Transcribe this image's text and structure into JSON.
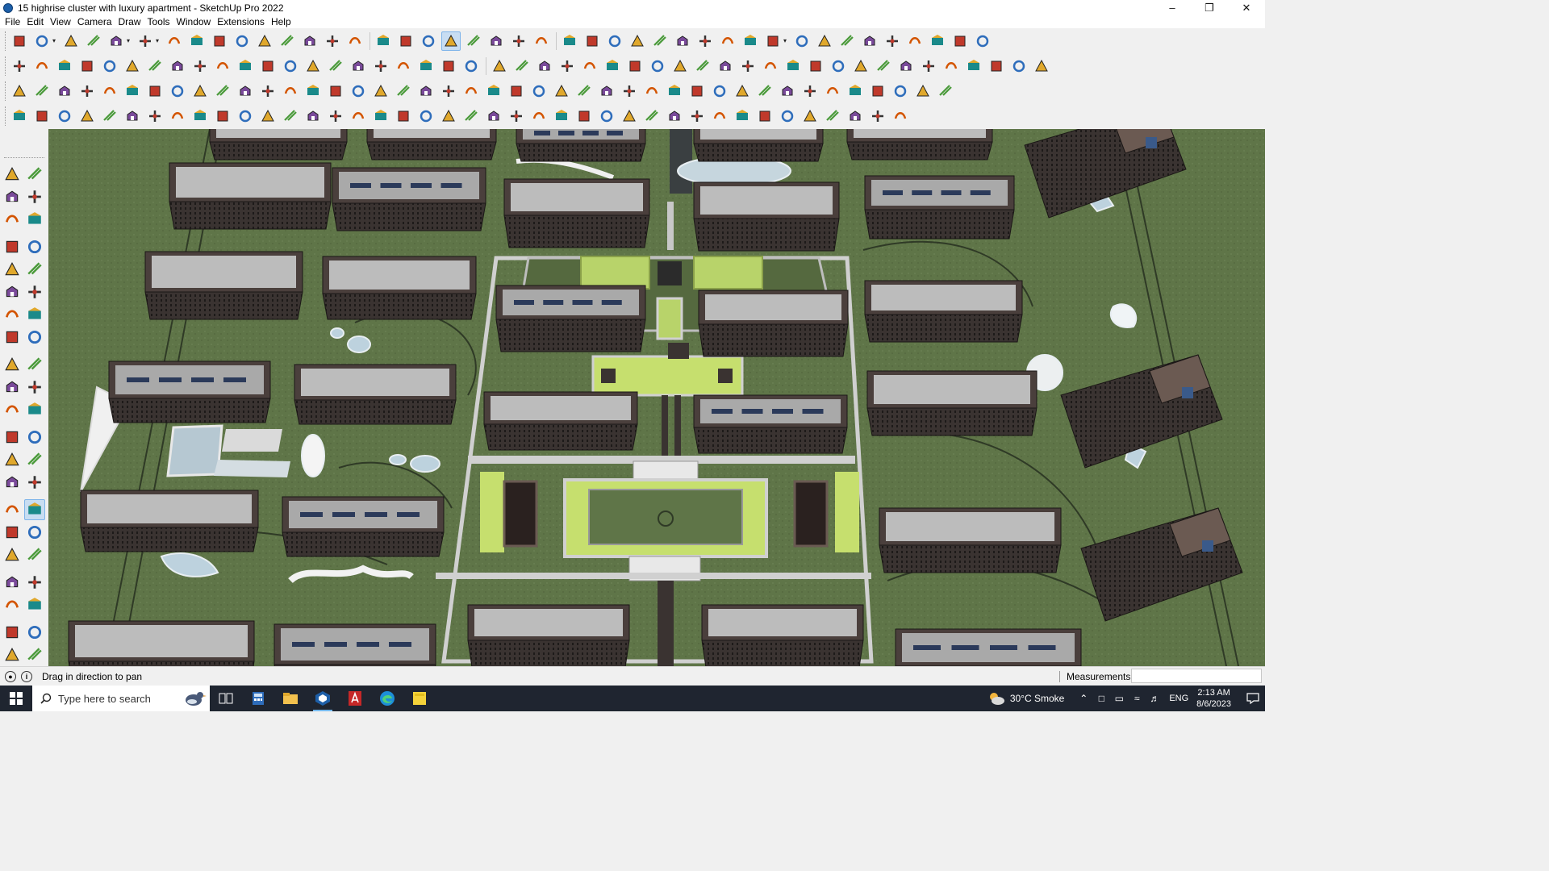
{
  "window": {
    "title": "15 highrise cluster with luxury apartment - SketchUp Pro 2022",
    "icons": [
      "sketchup-icon",
      "minimize-icon",
      "maximize-icon",
      "close-icon"
    ]
  },
  "menubar": [
    "File",
    "Edit",
    "View",
    "Camera",
    "Draw",
    "Tools",
    "Window",
    "Extensions",
    "Help"
  ],
  "toolbars": {
    "row1": [
      "zoom-extents",
      "select",
      "eraser",
      "line",
      "arc",
      "rectangle",
      "push-pull",
      "follow-me",
      "move",
      "rotate",
      "scale",
      "tape-measure",
      "text",
      "paint-bucket",
      "orbit",
      "pan",
      "zoom",
      "zoom-window",
      "styles",
      "section-plane",
      "layers",
      "components",
      "geolocation",
      "model-info",
      "shadow",
      "fog",
      "axis",
      "camera",
      "undo",
      "redo",
      "warehouse"
    ],
    "row2": [
      "components",
      "materials",
      "styles",
      "push-pull-extended",
      "move-x",
      "move-y",
      "move-z",
      "curve",
      "sandbox",
      "roof",
      "house",
      "walls",
      "terrain",
      "text-3d",
      "tape",
      "circles",
      "polygons",
      "arcs",
      "paint",
      "extrude",
      "solid"
    ],
    "row3": [
      "plane-blue",
      "plane-yellow",
      "plane-green",
      "plane-red",
      "offset",
      "polyline",
      "array",
      "section",
      "rotate-copy",
      "joint",
      "weld",
      "spline",
      "ortho",
      "scale-tool",
      "vertex",
      "grid",
      "hatch",
      "explode",
      "cluster"
    ],
    "row4": [
      "draw-edge",
      "bezier",
      "fillet",
      "chamfer",
      "lattice",
      "unfold",
      "bend",
      "loft",
      "sphere",
      "shell",
      "corner",
      "stair",
      "railing",
      "window-frame",
      "roof-truss",
      "beam",
      "grid-lines",
      "panel"
    ]
  },
  "left_toolbar": {
    "tools": [
      "select-icon",
      "orbit-icon",
      "paint-bucket-icon",
      "eraser-icon",
      "component-icon",
      "tape-icon",
      "pencil-icon",
      "freehand-icon",
      "rectangle-icon",
      "rotated-rect-icon",
      "circle-icon",
      "polygon-icon",
      "arc-icon",
      "arc-2point-icon",
      "pie-icon",
      "arc-3point-icon",
      "move-icon",
      "push-pull-icon",
      "rotate-icon",
      "follow-me-icon",
      "scale-icon",
      "offset-icon",
      "tape-measure-icon",
      "dimension-icon",
      "protractor-icon",
      "text-icon",
      "axes-icon",
      "3d-text-icon",
      "orbit2-icon",
      "pan-icon",
      "zoom-icon",
      "zoom-window-icon",
      "zoom-extents-icon",
      "previous-icon",
      "position-camera-icon",
      "look-around-icon",
      "walk-icon",
      "section-plane-icon",
      "styles-icon",
      "shadows-icon",
      "layers-icon",
      "fog-icon"
    ],
    "active": "pan-icon"
  },
  "status": {
    "hint": "Drag in direction to pan",
    "measurements_label": "Measurements",
    "measurements_value": ""
  },
  "taskbar": {
    "search_placeholder": "Type here to search",
    "apps": [
      "task-view-icon",
      "calculator-icon",
      "file-explorer-icon",
      "sketchup-icon",
      "acrobat-icon",
      "edge-icon",
      "sticky-notes-icon"
    ],
    "weather": "30°C  Smoke",
    "language": "ENG",
    "time": "2:13 AM",
    "date": "8/6/2023"
  },
  "colors": {
    "ground": "#5f7548",
    "building_roof": "#bcbcbc",
    "building_wall": "#3e3634",
    "lawn": "#b8d36a",
    "path": "#c8c8c8",
    "taskbar": "#1f2530",
    "active_tool": "#c8ddf2"
  }
}
